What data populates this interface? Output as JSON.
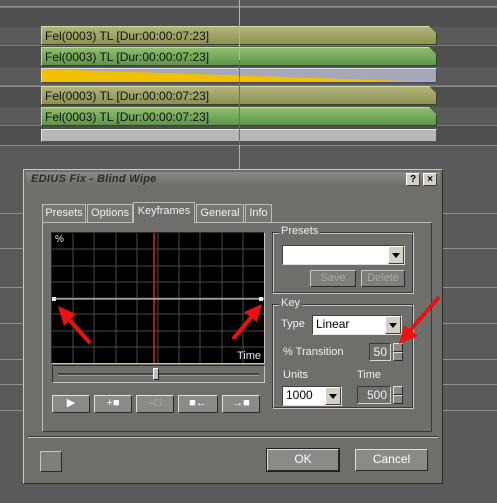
{
  "timeline": {
    "clips": [
      {
        "label": "Fel(0003)  TL [Dur:00:00:07:23]",
        "color": "olive"
      },
      {
        "label": "Fel(0003)  TL [Dur:00:00:07:23]",
        "color": "green"
      },
      {
        "label": "Fel(0003)  TL [Dur:00:00:07:23]",
        "color": "olive"
      },
      {
        "label": "Fel(0003)  TL [Dur:00:00:07:23]",
        "color": "green"
      }
    ],
    "transition_color": "#f2c000",
    "cursor_color": "#56d6e8"
  },
  "dialog": {
    "title": "EDIUS Fix - Blind Wipe",
    "help_button": "?",
    "close_button": "×",
    "tabs": [
      "Presets",
      "Options",
      "Keyframes",
      "General",
      "Info"
    ],
    "active_tab": "Keyframes",
    "graph": {
      "y_label": "%",
      "x_label": "Time"
    },
    "keyframe_buttons": [
      "▶",
      "+■",
      "–□",
      "■←",
      "→■"
    ],
    "presets": {
      "group_label": "Presets",
      "selected": "",
      "save_label": "Save",
      "delete_label": "Delete"
    },
    "key": {
      "group_label": "Key",
      "type_label": "Type",
      "type_value": "Linear",
      "transition_label": "% Transition",
      "transition_value": "50",
      "units_label": "Units",
      "units_value": "1000",
      "time_label": "Time",
      "time_value": "500"
    },
    "ok_label": "OK",
    "cancel_label": "Cancel"
  }
}
